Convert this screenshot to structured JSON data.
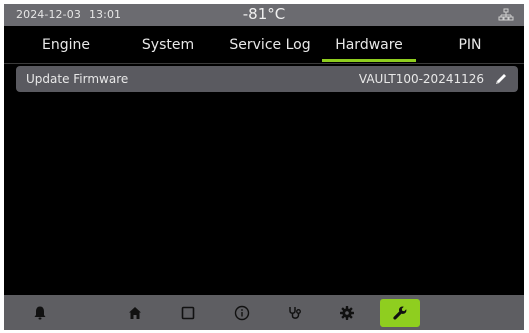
{
  "status_bar": {
    "date": "2024-12-03",
    "time": "13:01",
    "temperature": "-81°C",
    "network_icon": "network-icon"
  },
  "tabs": [
    {
      "label": "Engine",
      "active": false
    },
    {
      "label": "System",
      "active": false
    },
    {
      "label": "Service Log",
      "active": false
    },
    {
      "label": "Hardware",
      "active": true
    },
    {
      "label": "PIN",
      "active": false
    }
  ],
  "settings": [
    {
      "label": "Update Firmware",
      "value": "VAULT100-20241126",
      "action_icon": "edit-icon"
    }
  ],
  "bottom_nav": [
    {
      "icon": "bell-icon",
      "active": false
    },
    {
      "icon": "home-icon",
      "active": false
    },
    {
      "icon": "square-icon",
      "active": false
    },
    {
      "icon": "info-icon",
      "active": false
    },
    {
      "icon": "stethoscope-icon",
      "active": false
    },
    {
      "icon": "gear-icon",
      "active": false
    },
    {
      "icon": "wrench-icon",
      "active": true
    }
  ],
  "colors": {
    "accent": "#8fce1f",
    "screen_background": "#000000",
    "bar_gray": "#6b6b70",
    "row_gray": "#5a5a60"
  }
}
